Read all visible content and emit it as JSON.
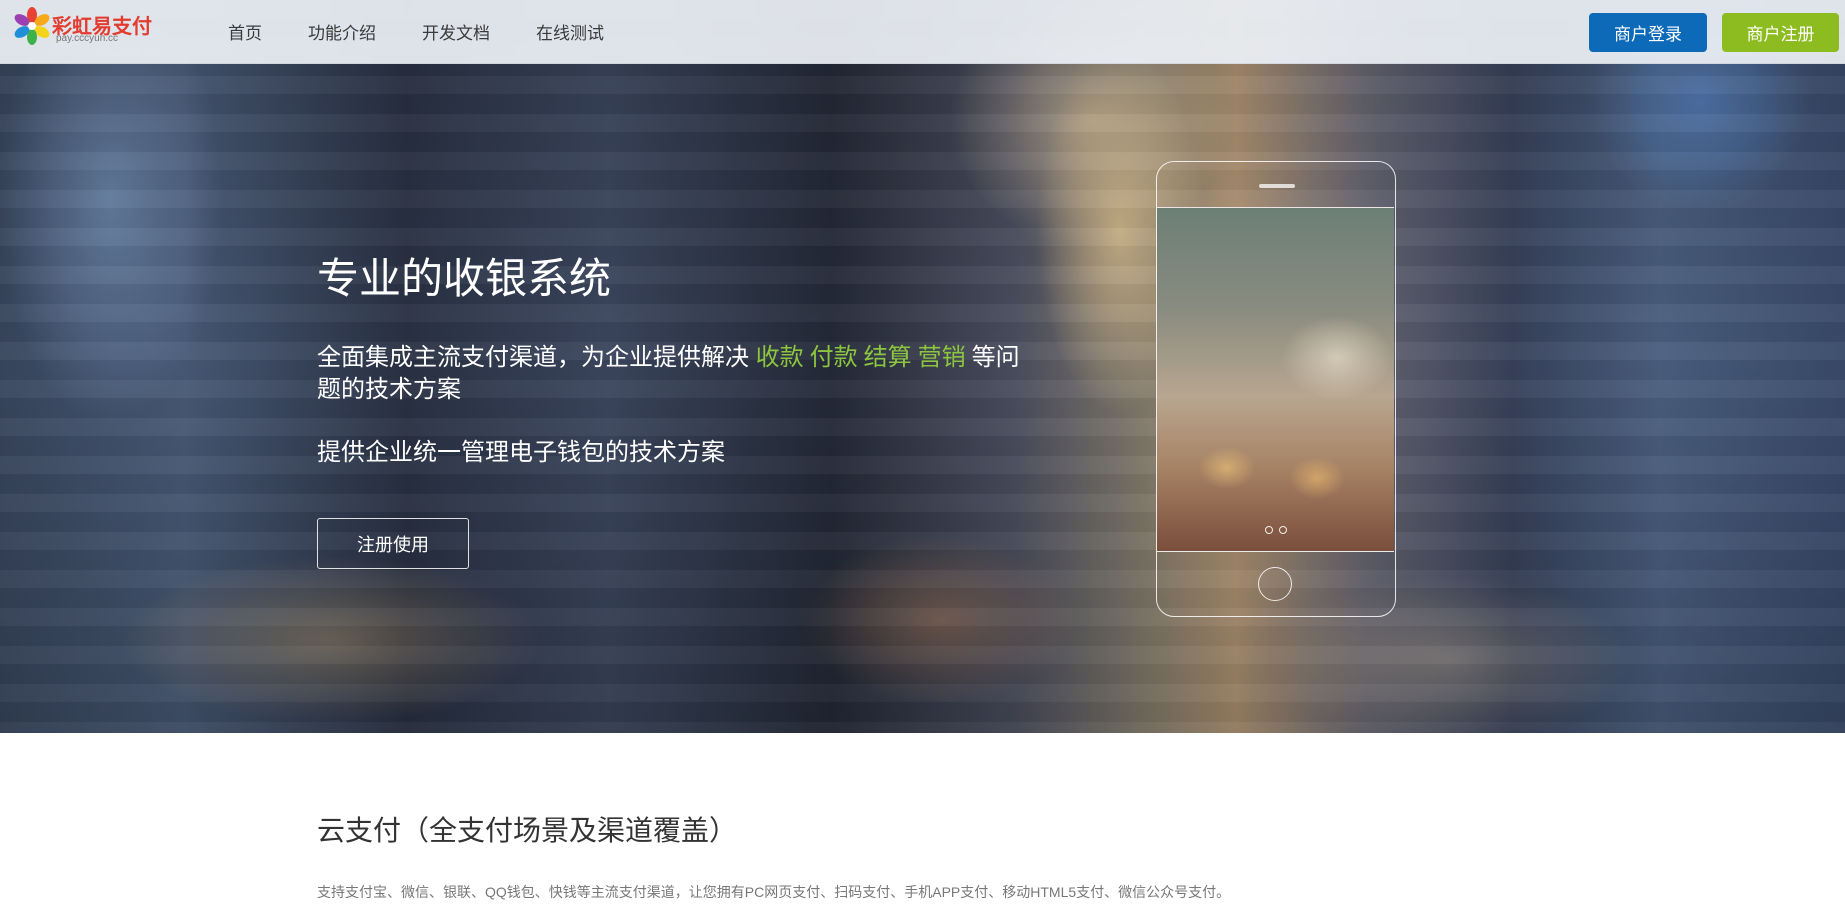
{
  "brand": {
    "name": "彩虹易支付",
    "domain": "pay.cccyun.cc"
  },
  "nav": {
    "links": [
      "首页",
      "功能介绍",
      "开发文档",
      "在线测试"
    ],
    "login_label": "商户登录",
    "register_label": "商户注册"
  },
  "hero": {
    "title": "专业的收银系统",
    "desc_prefix": "全面集成主流支付渠道，为企业提供解决 ",
    "highlights": [
      "收款",
      "付款",
      "结算",
      "营销"
    ],
    "desc_suffix": "等问题的技术方案",
    "desc2": "提供企业统一管理电子钱包的技术方案",
    "cta_label": "注册使用"
  },
  "section": {
    "title": "云支付（全支付场景及渠道覆盖）",
    "desc": "支持支付宝、微信、银联、QQ钱包、快钱等主流支付渠道，让您拥有PC网页支付、扫码支付、手机APP支付、移动HTML5支付、微信公众号支付。"
  },
  "colors": {
    "login_button": "#0d6ab8",
    "register_button": "#8cbc1f",
    "highlight_text": "#8cc63f",
    "logo_text": "#e33b2e"
  },
  "icons": {
    "logo": "rainbow-flower-icon",
    "phone": "smartphone-outline-icon"
  }
}
